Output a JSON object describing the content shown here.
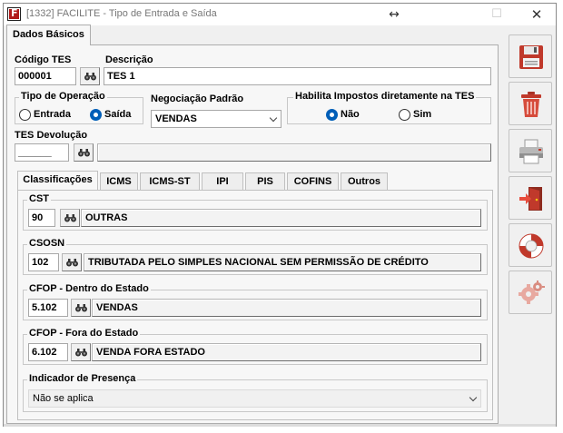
{
  "window": {
    "title": "[1332] FACILITE - Tipo de Entrada e Saída",
    "resize_glyph": "↔",
    "max_glyph": "☐",
    "close_glyph": "✕"
  },
  "main_tabs": [
    {
      "label": "Dados Básicos"
    }
  ],
  "form": {
    "codigo_label": "Código TES",
    "codigo_value": "000001",
    "descricao_label": "Descrição",
    "descricao_value": "TES 1",
    "tipo_operacao": {
      "label": "Tipo de Operação",
      "options": [
        "Entrada",
        "Saída"
      ],
      "selected": "Saída"
    },
    "negociacao": {
      "label": "Negociação Padrão",
      "value": "VENDAS"
    },
    "habilita": {
      "label": "Habilita Impostos diretamente na TES",
      "options": [
        "Não",
        "Sim"
      ],
      "selected": "Não"
    },
    "devolucao_label": "TES Devolução",
    "devolucao_value": "______",
    "devolucao_desc": ""
  },
  "inner_tabs": [
    "Classificações",
    "ICMS",
    "ICMS-ST",
    "IPI",
    "PIS",
    "COFINS",
    "Outros"
  ],
  "classificacoes": {
    "cst": {
      "label": "CST",
      "code": "90",
      "desc": "OUTRAS"
    },
    "csosn": {
      "label": "CSOSN",
      "code": "102",
      "desc": "TRIBUTADA PELO SIMPLES NACIONAL SEM PERMISSÃO DE CRÉDITO"
    },
    "cfop_dentro": {
      "label": "CFOP - Dentro do Estado",
      "code": "5.102",
      "desc": "VENDAS"
    },
    "cfop_fora": {
      "label": "CFOP - Fora do Estado",
      "code": "6.102",
      "desc": "VENDA FORA ESTADO"
    },
    "indicador": {
      "label": "Indicador de Presença",
      "value": "Não se aplica"
    }
  },
  "side_buttons": [
    "save-icon",
    "trash-icon",
    "printer-icon",
    "exit-door-icon",
    "lifebuoy-help-icon",
    "settings-gear-icon"
  ],
  "colors": {
    "accent": "#005fb8",
    "icon_red": "#c0392b"
  }
}
